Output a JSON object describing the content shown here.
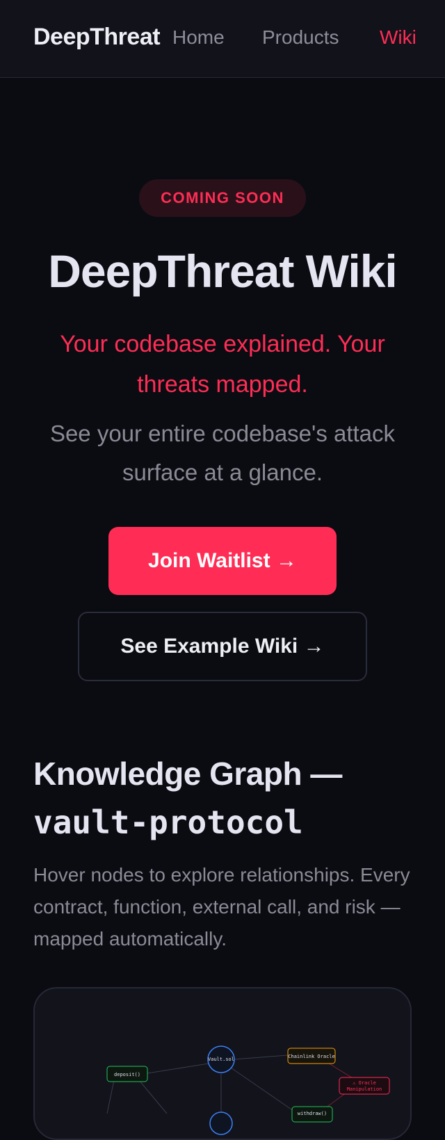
{
  "nav": {
    "brand": "DeepThreat",
    "links": [
      {
        "label": "Home"
      },
      {
        "label": "Products"
      },
      {
        "label": "Wiki"
      }
    ],
    "active_color": "#ff2d55"
  },
  "hero": {
    "badge": "COMING SOON",
    "title": "DeepThreat Wiki",
    "tagline": "Your codebase explained. Your threats mapped.",
    "subtitle": "See your entire codebase's attack surface at a glance.",
    "primary_button": "Join Waitlist →",
    "secondary_button": "See Example Wiki →"
  },
  "graph_section": {
    "title": "Knowledge Graph —",
    "project": "vault-protocol",
    "description": "Hover nodes to explore relationships. Every contract, function, external call, and risk — mapped automatically.",
    "nodes": [
      {
        "label": "Vault.sol",
        "kind": "contract",
        "color": "#3b82f6"
      },
      {
        "label": "Chainlink Oracle",
        "kind": "external",
        "color": "#f59e0b"
      },
      {
        "label": "deposit()",
        "kind": "function",
        "color": "#22c55e"
      },
      {
        "label": "withdraw()",
        "kind": "function",
        "color": "#22c55e"
      },
      {
        "label": "⚠ Oracle",
        "kind": "risk",
        "color": "#ff2d55"
      },
      {
        "label": "Manipulation",
        "kind": "risk",
        "color": "#ff2d55"
      }
    ]
  },
  "colors": {
    "background": "#0b0c12",
    "accent": "#ff2d55",
    "muted": "#8a8b95"
  }
}
